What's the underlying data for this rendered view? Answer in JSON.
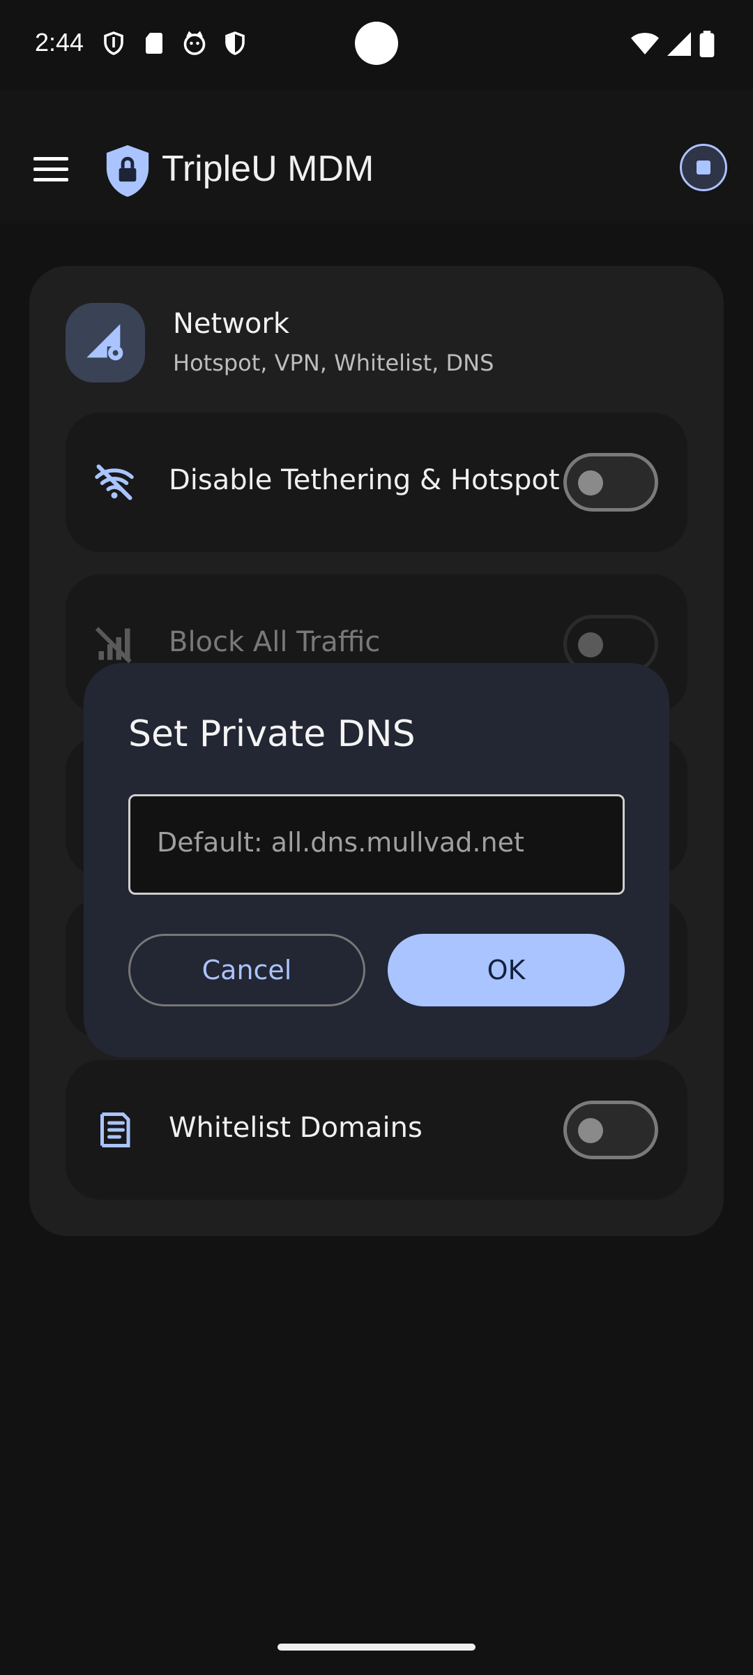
{
  "status_bar": {
    "time": "2:44",
    "icons": [
      "shield-outline-icon",
      "sd-card-icon",
      "cat-face-icon",
      "shield-half-icon"
    ],
    "right_icons": [
      "wifi-icon",
      "cell-signal-icon",
      "battery-icon"
    ]
  },
  "app_bar": {
    "title": "TripleU MDM",
    "menu_icon": "menu-icon",
    "logo_icon": "shield-lock-icon",
    "action_icon": "stop-icon",
    "accent_color": "#aac4ff"
  },
  "card": {
    "title": "Network",
    "subtitle": "Hotspot, VPN, Whitelist, DNS",
    "icon": "network-settings-icon",
    "items": [
      {
        "label": "Disable Tethering & Hotspot",
        "icon": "wifi-off-icon",
        "enabled": false
      },
      {
        "label": "Block All Traffic",
        "icon": "signal-off-icon",
        "enabled": false,
        "disabled": true
      },
      {
        "label": "Whitelist Domains",
        "icon": "list-icon",
        "enabled": false
      }
    ]
  },
  "dialog": {
    "title": "Set Private DNS",
    "input_value": "",
    "input_placeholder": "Default: all.dns.mullvad.net",
    "cancel_label": "Cancel",
    "ok_label": "OK"
  }
}
